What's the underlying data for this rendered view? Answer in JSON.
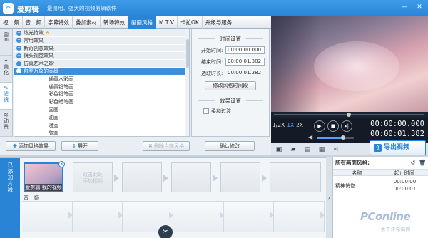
{
  "titlebar": {
    "app_name": "爱剪辑",
    "slogan": "最易用、强大的视频剪辑软件"
  },
  "main_tabs": [
    "视　频",
    "音　频",
    "字幕特效",
    "叠加素材",
    "转场特效",
    "画面风格",
    "M T V",
    "卡拉OK",
    "升级与服务"
  ],
  "active_tab": "画面风格",
  "side_tabs": [
    "画面",
    "美化",
    "滤镜",
    "动景"
  ],
  "active_side_tab": "滤镜",
  "tree": {
    "items": [
      {
        "label": "炫光特效",
        "type": "cat",
        "star": true
      },
      {
        "label": "常用效果",
        "type": "cat"
      },
      {
        "label": "新奇创意效果",
        "type": "cat"
      },
      {
        "label": "镜头视觉效果",
        "type": "cat"
      },
      {
        "label": "仿真艺术之妙",
        "type": "cat"
      },
      {
        "label": "包罗万象的画风",
        "type": "cat",
        "selected": true
      },
      {
        "label": "通真水彩画",
        "type": "sub"
      },
      {
        "label": "通真铅笔画",
        "type": "sub"
      },
      {
        "label": "彩色铅笔画",
        "type": "sub"
      },
      {
        "label": "彩色蜡笔画",
        "type": "sub"
      },
      {
        "label": "国画",
        "type": "sub"
      },
      {
        "label": "油画",
        "type": "sub"
      },
      {
        "label": "漫画",
        "type": "sub"
      },
      {
        "label": "版画",
        "type": "sub"
      }
    ]
  },
  "time_settings": {
    "title": "时间设置",
    "start_label": "开始时间:",
    "start_value": "00:00:00.000",
    "end_label": "结束时间:",
    "end_value": "00:00:01.382",
    "duration_label": "选取时长:",
    "duration_value": "00:00:01.382",
    "modify_button": "修改风格时间段"
  },
  "effect_settings": {
    "title": "效果设置",
    "fade_label": "柔和过渡",
    "fade_checked": false
  },
  "actions": {
    "add_effect": "添加风格效果",
    "expand": "展开",
    "delete_current": "删除当前风格",
    "confirm": "确认修改"
  },
  "player": {
    "speeds": [
      "1/2X",
      "1X",
      "2X"
    ],
    "current_speed": "1X",
    "current_time": "00:00:00.000",
    "total_time": "00:00:01.382",
    "volume_fraction": 0.72,
    "progress_fraction": 0.5
  },
  "export_button": "导出视频",
  "timeline": {
    "added_label": "已添加片段",
    "clip_name": "爱剪辑-我的视频",
    "empty_hint": "双击此处\n添加视频",
    "audio_label": "音　频"
  },
  "right_panel": {
    "title": "所有画面风格:",
    "col_name": "名称",
    "col_time": "起止时间",
    "rows": [
      {
        "name": "精神恍惚",
        "start": "00:00:00",
        "end": "00:00:01"
      }
    ]
  },
  "watermark": {
    "text": "PConline",
    "sub": "太平洋电脑网"
  },
  "colors": {
    "accent": "#2a84d6",
    "dark": "#141b26"
  },
  "icons": {
    "logo": "app-logo",
    "export": "export-icon",
    "scissor": "scissor-icon"
  }
}
